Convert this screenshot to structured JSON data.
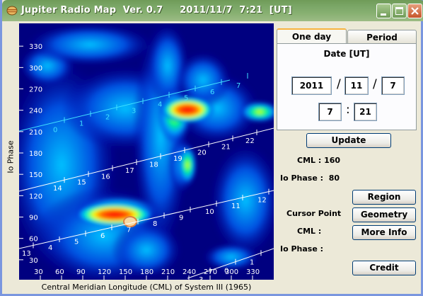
{
  "window": {
    "title": "Jupiter Radio Map  Ver. 0.7     2011/11/7  7:21  [UT]",
    "accent": "#7BA767"
  },
  "plot": {
    "ylabel": "Io Phase",
    "xlabel": "Central Meridian Longitude (CML) of System III (1965)",
    "yticks": [
      "330",
      "300",
      "270",
      "240",
      "210",
      "180",
      "150",
      "120",
      "90",
      "60",
      "30"
    ],
    "xticks": [
      "30",
      "60",
      "90",
      "120",
      "150",
      "180",
      "210",
      "240",
      "270",
      "300",
      "330"
    ],
    "tracks": [
      {
        "labels": [
          "0",
          "1",
          "2",
          "3",
          "4",
          "5",
          "6",
          "7"
        ]
      },
      {
        "labels": [
          "14",
          "15",
          "16",
          "17",
          "18",
          "19",
          "20",
          "21",
          "22"
        ]
      },
      {
        "labels": [
          "13",
          "4",
          "5",
          "6",
          "7",
          "8",
          "9",
          "10",
          "11",
          "12"
        ]
      },
      {
        "labels": [
          "3",
          "0",
          "1",
          "2"
        ]
      }
    ]
  },
  "tabs": {
    "one_day": "One day",
    "period": "Period"
  },
  "date": {
    "label": "Date  [UT]",
    "year": "2011",
    "month": "11",
    "day": "7",
    "hour": "7",
    "minute": "21",
    "sep_slash": "/",
    "sep_colon": ":"
  },
  "buttons": {
    "update": "Update",
    "region": "Region",
    "geometry": "Geometry",
    "more_info": "More Info",
    "credit": "Credit"
  },
  "info": {
    "cml": "CML : 160",
    "io_phase": "Io Phase :  80",
    "cursor_point": "Cursor Point",
    "cursor_cml": "CML :",
    "cursor_io": "Io Phase :"
  }
}
